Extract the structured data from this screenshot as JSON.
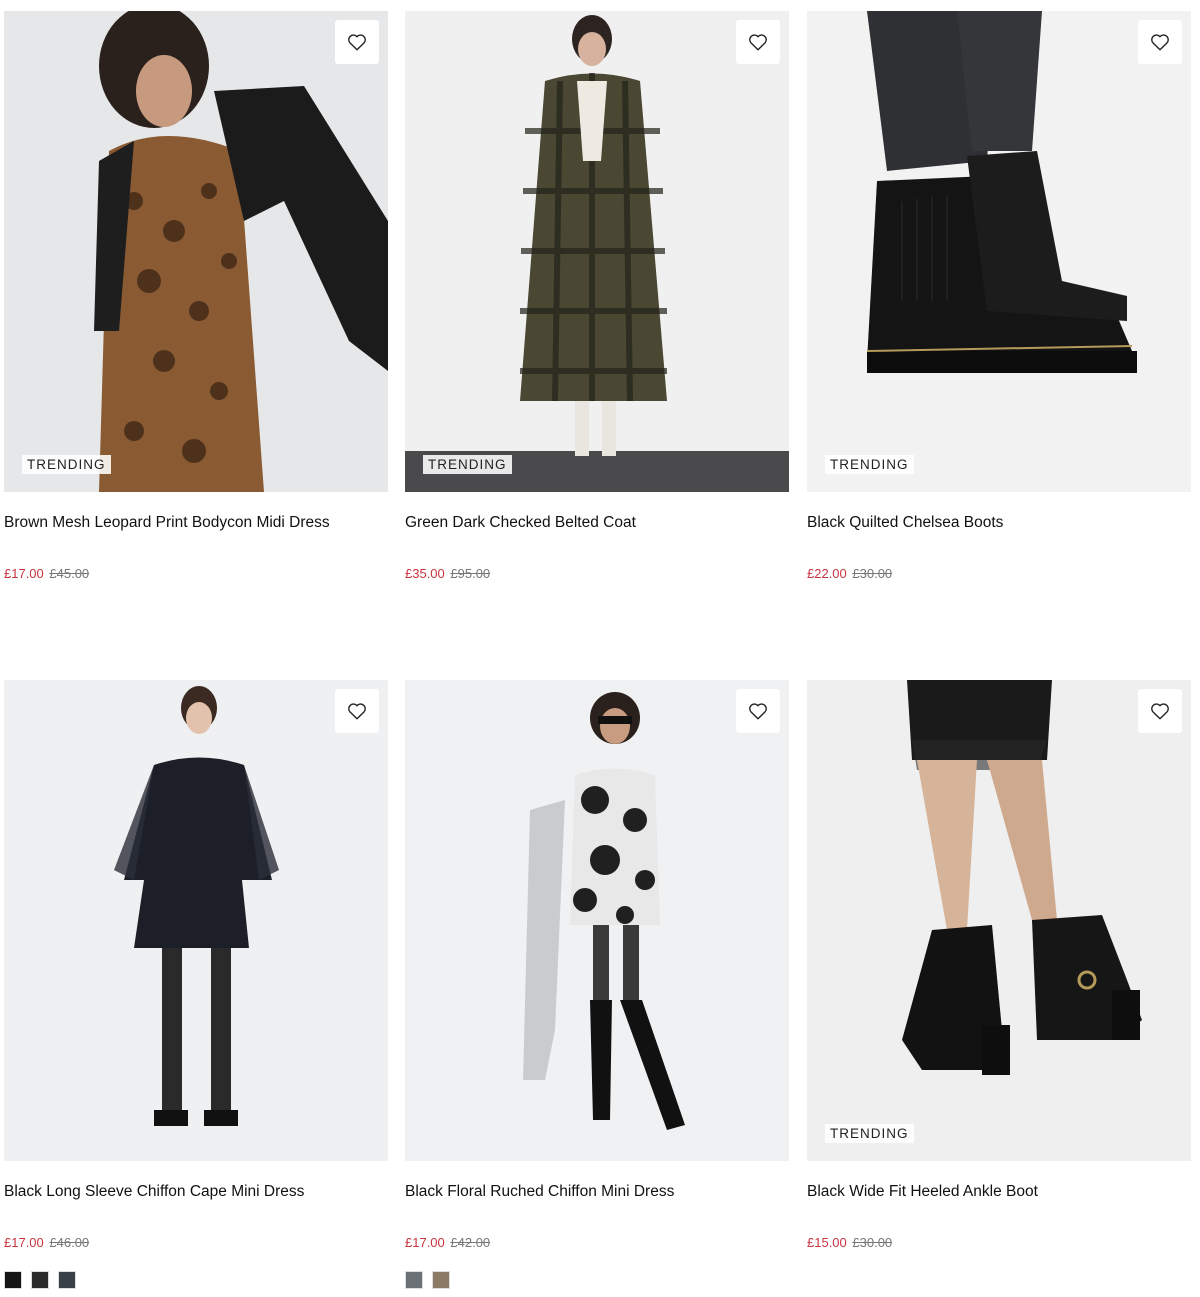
{
  "products": [
    {
      "name": "Brown Mesh Leopard Print Bodycon Midi Dress",
      "price_now": "£17.00",
      "price_was": "£45.00",
      "badge": "TRENDING",
      "swatches": []
    },
    {
      "name": "Green Dark Checked Belted Coat",
      "price_now": "£35.00",
      "price_was": "£95.00",
      "badge": "TRENDING",
      "swatches": []
    },
    {
      "name": "Black Quilted Chelsea Boots",
      "price_now": "£22.00",
      "price_was": "£30.00",
      "badge": "TRENDING",
      "swatches": []
    },
    {
      "name": "Black Long Sleeve Chiffon Cape Mini Dress",
      "price_now": "£17.00",
      "price_was": "£46.00",
      "badge": "",
      "swatches": [
        "#151515",
        "#2b2b2b",
        "#3a4146"
      ]
    },
    {
      "name": "Black Floral Ruched Chiffon Mini Dress",
      "price_now": "£17.00",
      "price_was": "£42.00",
      "badge": "",
      "swatches": [
        "#6b7075",
        "#8a7a66"
      ]
    },
    {
      "name": "Black Wide Fit Heeled Ankle Boot",
      "price_now": "£15.00",
      "price_was": "£30.00",
      "badge": "TRENDING",
      "swatches": []
    }
  ],
  "icons": {
    "wishlist": "heart-outline-icon"
  },
  "colors": {
    "sale_price": "#c9343f",
    "was_price": "#777777",
    "text": "#111111"
  }
}
